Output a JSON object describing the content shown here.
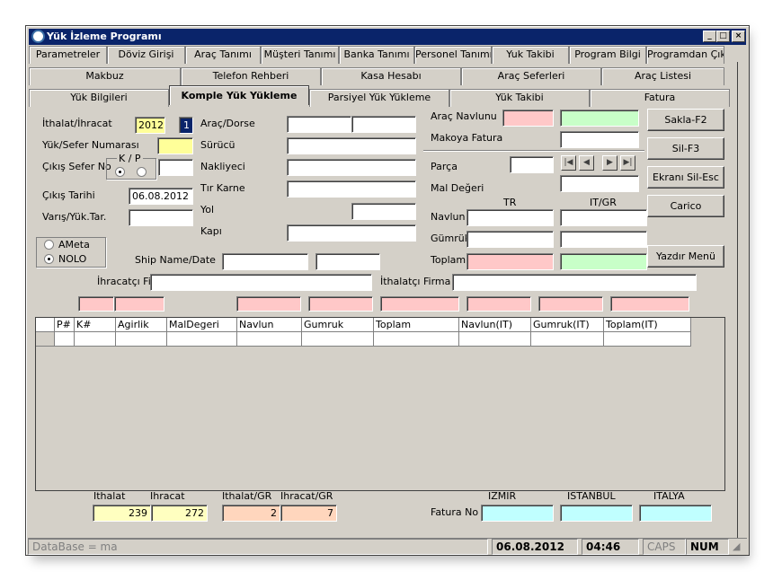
{
  "window": {
    "title": "Yük İzleme Programı",
    "min": "_",
    "max": "□",
    "close": "×"
  },
  "menu_row1": [
    "Parametreler",
    "Döviz Girişi",
    "Araç Tanımı",
    "Müşteri Tanımı",
    "Banka Tanımı",
    "Personel Tanımı",
    "Yuk Takibi",
    "Program Bilgi",
    "Programdan Çık"
  ],
  "menu_row2": [
    "Makbuz",
    "Telefon Rehberi",
    "Kasa Hesabı",
    "Araç Seferleri",
    "Araç Listesi"
  ],
  "tabs": [
    "Yük Bilgileri",
    "Komple Yük Yükleme",
    "Parsiyel Yük Yükleme",
    "Yük Takibi",
    "Fatura"
  ],
  "form": {
    "ithalat_label": "İthalat/İhracat",
    "ithalat_year": "2012",
    "ithalat_no": "1",
    "sefer_no_label": "Yük/Sefer Numarası",
    "sefer_no": "",
    "cikis_sefer_label": "Çıkış Sefer No",
    "kp_label": "K / P",
    "cikis_tarihi_label": "Çıkış Tarihi",
    "cikis_tarihi": "06.08.2012",
    "varis_label": "Varış/Yük.Tar.",
    "arac_dorse_label": "Araç/Dorse",
    "surucu_label": "Sürücü",
    "nakliyeci_label": "Nakliyeci",
    "tir_karne_label": "Tır Karne",
    "yol_label": "Yol",
    "kapi_label": "Kapı",
    "ameta_label": "AMeta",
    "nolo_label": "NOLO",
    "ship_label": "Ship Name/Date",
    "arac_navlunu_label": "Araç Navlunu",
    "makoya_label": "Makoya Fatura",
    "parca_label": "Parça",
    "mal_degeri_label": "Mal Değeri",
    "tr_label": "TR",
    "itgr_label": "IT/GR",
    "navlun_label": "Navlun",
    "gumruk_label": "Gümrük",
    "toplam_label": "Toplam:",
    "ihracatci_label": "İhracatçı Firma",
    "ithalatci_label": "İthalatçı Firma"
  },
  "buttons": {
    "sakla": "Sakla-F2",
    "sil": "Sil-F3",
    "ekrani_sil": "Ekranı Sil-Esc",
    "carico": "Carico",
    "yazdir": "Yazdır Menü"
  },
  "grid_columns": [
    "P#",
    "K#",
    "Agirlik",
    "MalDegeri",
    "Navlun",
    "Gumruk",
    "Toplam",
    "Navlun(IT)",
    "Gumruk(IT)",
    "Toplam(IT)"
  ],
  "footer": {
    "ithalat_label": "Ithalat",
    "ihracat_label": "Ihracat",
    "ithalat_gr_label": "Ithalat/GR",
    "ihracat_gr_label": "Ihracat/GR",
    "ithalat": "239",
    "ihracat": "272",
    "ithalat_gr": "2",
    "ihracat_gr": "7",
    "fatura_no_label": "Fatura No",
    "izmir_label": "IZMIR",
    "istanbul_label": "ISTANBUL",
    "italya_label": "ITALYA"
  },
  "status": {
    "db": "DataBase = ma",
    "date": "06.08.2012",
    "time": "04:46",
    "caps": "CAPS",
    "num": "NUM"
  }
}
